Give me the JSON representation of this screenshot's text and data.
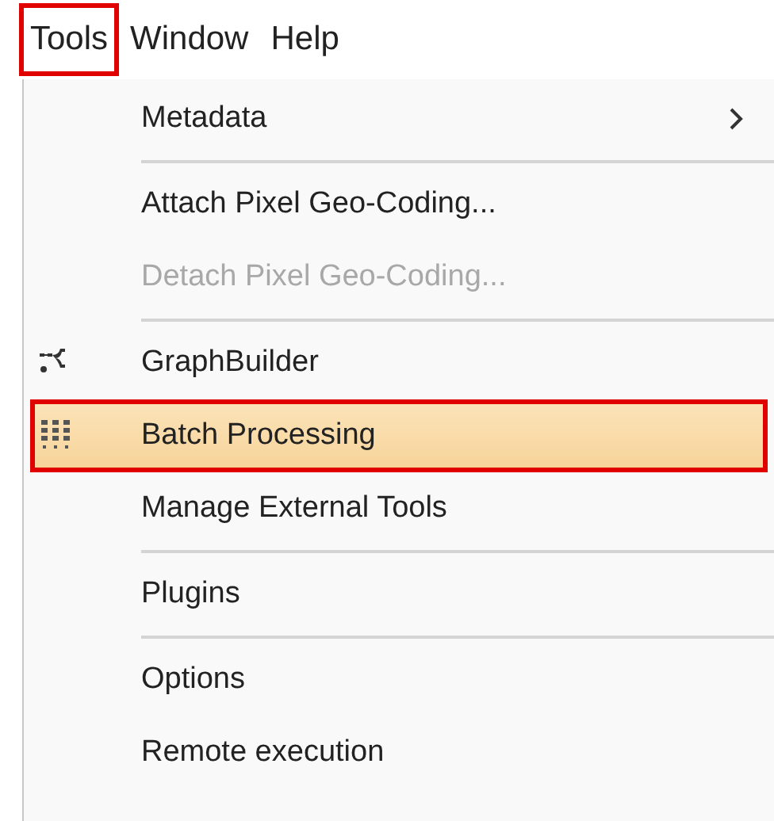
{
  "menubar": [
    {
      "label": "Tools",
      "highlighted": true
    },
    {
      "label": "Window",
      "highlighted": false
    },
    {
      "label": "Help",
      "highlighted": false
    }
  ],
  "menu": [
    {
      "kind": "item",
      "label": "Metadata",
      "submenu": true,
      "disabled": false,
      "highlighted": false
    },
    {
      "kind": "separator"
    },
    {
      "kind": "item",
      "label": "Attach Pixel Geo-Coding...",
      "submenu": false,
      "disabled": false,
      "highlighted": false
    },
    {
      "kind": "item",
      "label": "Detach Pixel Geo-Coding...",
      "submenu": false,
      "disabled": true,
      "highlighted": false
    },
    {
      "kind": "separator"
    },
    {
      "kind": "graph",
      "label": "GraphBuilder",
      "submenu": false,
      "disabled": false,
      "highlighted": false
    },
    {
      "kind": "batch",
      "label": "Batch Processing",
      "submenu": false,
      "disabled": false,
      "highlighted": true
    },
    {
      "kind": "item",
      "label": "Manage External Tools",
      "submenu": false,
      "disabled": false,
      "highlighted": false
    },
    {
      "kind": "separator"
    },
    {
      "kind": "item",
      "label": "Plugins",
      "submenu": false,
      "disabled": false,
      "highlighted": false
    },
    {
      "kind": "separator"
    },
    {
      "kind": "item",
      "label": "Options",
      "submenu": false,
      "disabled": false,
      "highlighted": false
    },
    {
      "kind": "item",
      "label": "Remote execution",
      "submenu": false,
      "disabled": false,
      "highlighted": false
    }
  ]
}
